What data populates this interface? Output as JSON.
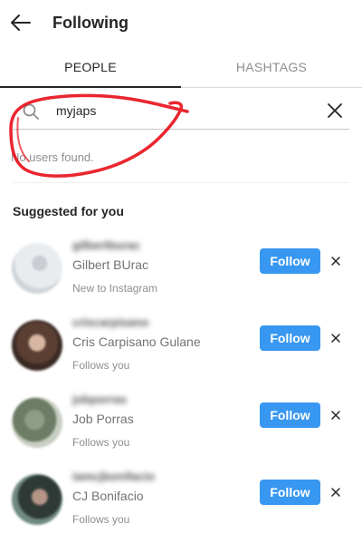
{
  "header": {
    "title": "Following",
    "back_icon": "arrow-left-icon"
  },
  "tabs": [
    {
      "label": "PEOPLE",
      "active": true
    },
    {
      "label": "HASHTAGS",
      "active": false
    }
  ],
  "search": {
    "value": "myjaps",
    "icon": "search-icon",
    "clear_icon": "close-icon"
  },
  "empty_message": "No users found.",
  "annotation_color": "#e8141c",
  "suggested": {
    "title": "Suggested for you",
    "follow_label": "Follow",
    "dismiss_icon": "close-icon",
    "accent_color": "#3897f0",
    "items": [
      {
        "username": "gilbertburac",
        "full_name": "Gilbert BUrac",
        "reason": "New to Instagram"
      },
      {
        "username": "criscarpisano",
        "full_name": "Cris Carpisano Gulane",
        "reason": "Follows you"
      },
      {
        "username": "jobporras",
        "full_name": "Job Porras",
        "reason": "Follows you"
      },
      {
        "username": "iamcjbonifacio",
        "full_name": "CJ Bonifacio",
        "reason": "Follows you"
      }
    ]
  }
}
